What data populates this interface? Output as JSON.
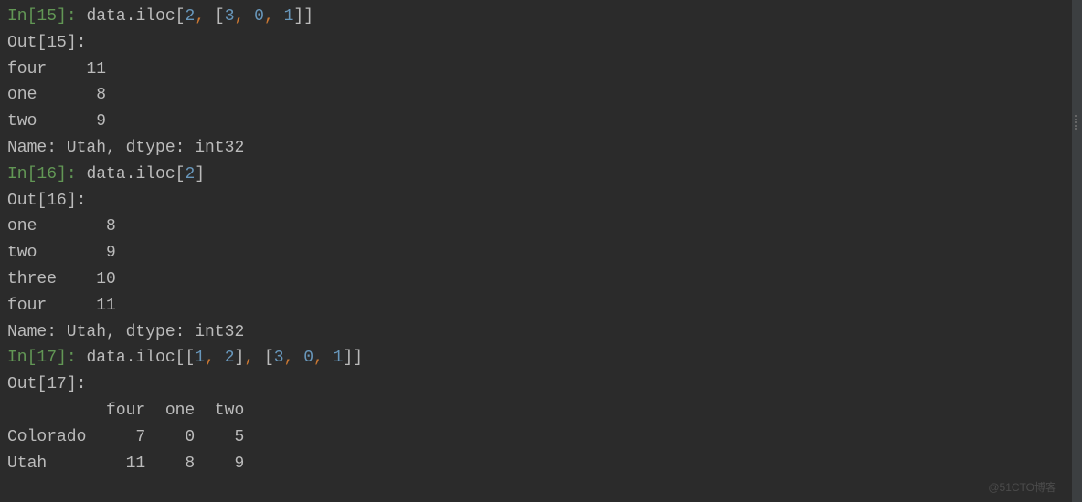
{
  "cells": {
    "c15": {
      "in_prompt_label": "In",
      "in_prompt_num": "15",
      "code_pre": "data.iloc[",
      "args": [
        "2",
        "3",
        "0",
        "1"
      ],
      "out_prompt_label": "Out",
      "out_prompt_num": "15",
      "rows": [
        {
          "label": "four",
          "value": "11"
        },
        {
          "label": "one",
          "value": "8"
        },
        {
          "label": "two",
          "value": "9"
        }
      ],
      "footer": "Name: Utah, dtype: int32"
    },
    "c16": {
      "in_prompt_label": "In",
      "in_prompt_num": "16",
      "code_pre": "data.iloc[",
      "arg": "2",
      "out_prompt_label": "Out",
      "out_prompt_num": "16",
      "rows": [
        {
          "label": "one",
          "value": "8"
        },
        {
          "label": "two",
          "value": "9"
        },
        {
          "label": "three",
          "value": "10"
        },
        {
          "label": "four",
          "value": "11"
        }
      ],
      "footer": "Name: Utah, dtype: int32"
    },
    "c17": {
      "in_prompt_label": "In",
      "in_prompt_num": "17",
      "code_pre": "data.iloc[[",
      "args_a": [
        "1",
        "2"
      ],
      "args_b": [
        "3",
        "0",
        "1"
      ],
      "out_prompt_label": "Out",
      "out_prompt_num": "17",
      "header": "          four  one  two",
      "row1": "Colorado     7    0    5",
      "row2": "Utah        11    8    9"
    }
  },
  "watermark": "@51CTO博客"
}
